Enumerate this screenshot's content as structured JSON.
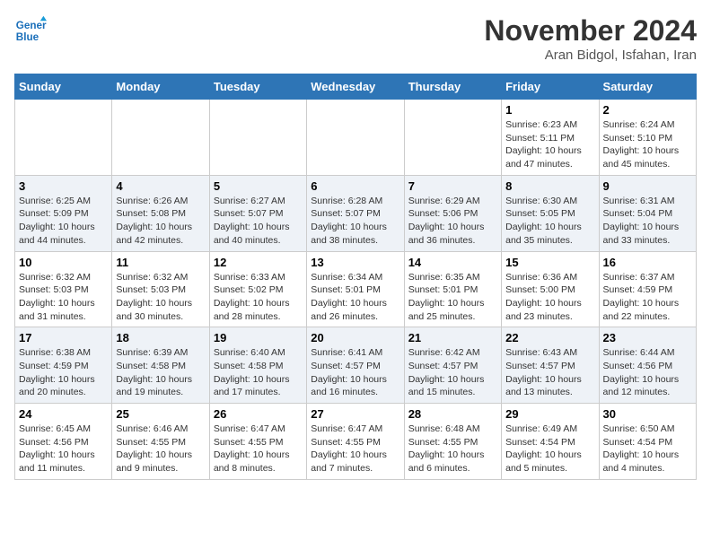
{
  "header": {
    "logo_line1": "General",
    "logo_line2": "Blue",
    "month": "November 2024",
    "location": "Aran Bidgol, Isfahan, Iran"
  },
  "weekdays": [
    "Sunday",
    "Monday",
    "Tuesday",
    "Wednesday",
    "Thursday",
    "Friday",
    "Saturday"
  ],
  "weeks": [
    [
      {
        "day": "",
        "info": ""
      },
      {
        "day": "",
        "info": ""
      },
      {
        "day": "",
        "info": ""
      },
      {
        "day": "",
        "info": ""
      },
      {
        "day": "",
        "info": ""
      },
      {
        "day": "1",
        "info": "Sunrise: 6:23 AM\nSunset: 5:11 PM\nDaylight: 10 hours and 47 minutes."
      },
      {
        "day": "2",
        "info": "Sunrise: 6:24 AM\nSunset: 5:10 PM\nDaylight: 10 hours and 45 minutes."
      }
    ],
    [
      {
        "day": "3",
        "info": "Sunrise: 6:25 AM\nSunset: 5:09 PM\nDaylight: 10 hours and 44 minutes."
      },
      {
        "day": "4",
        "info": "Sunrise: 6:26 AM\nSunset: 5:08 PM\nDaylight: 10 hours and 42 minutes."
      },
      {
        "day": "5",
        "info": "Sunrise: 6:27 AM\nSunset: 5:07 PM\nDaylight: 10 hours and 40 minutes."
      },
      {
        "day": "6",
        "info": "Sunrise: 6:28 AM\nSunset: 5:07 PM\nDaylight: 10 hours and 38 minutes."
      },
      {
        "day": "7",
        "info": "Sunrise: 6:29 AM\nSunset: 5:06 PM\nDaylight: 10 hours and 36 minutes."
      },
      {
        "day": "8",
        "info": "Sunrise: 6:30 AM\nSunset: 5:05 PM\nDaylight: 10 hours and 35 minutes."
      },
      {
        "day": "9",
        "info": "Sunrise: 6:31 AM\nSunset: 5:04 PM\nDaylight: 10 hours and 33 minutes."
      }
    ],
    [
      {
        "day": "10",
        "info": "Sunrise: 6:32 AM\nSunset: 5:03 PM\nDaylight: 10 hours and 31 minutes."
      },
      {
        "day": "11",
        "info": "Sunrise: 6:32 AM\nSunset: 5:03 PM\nDaylight: 10 hours and 30 minutes."
      },
      {
        "day": "12",
        "info": "Sunrise: 6:33 AM\nSunset: 5:02 PM\nDaylight: 10 hours and 28 minutes."
      },
      {
        "day": "13",
        "info": "Sunrise: 6:34 AM\nSunset: 5:01 PM\nDaylight: 10 hours and 26 minutes."
      },
      {
        "day": "14",
        "info": "Sunrise: 6:35 AM\nSunset: 5:01 PM\nDaylight: 10 hours and 25 minutes."
      },
      {
        "day": "15",
        "info": "Sunrise: 6:36 AM\nSunset: 5:00 PM\nDaylight: 10 hours and 23 minutes."
      },
      {
        "day": "16",
        "info": "Sunrise: 6:37 AM\nSunset: 4:59 PM\nDaylight: 10 hours and 22 minutes."
      }
    ],
    [
      {
        "day": "17",
        "info": "Sunrise: 6:38 AM\nSunset: 4:59 PM\nDaylight: 10 hours and 20 minutes."
      },
      {
        "day": "18",
        "info": "Sunrise: 6:39 AM\nSunset: 4:58 PM\nDaylight: 10 hours and 19 minutes."
      },
      {
        "day": "19",
        "info": "Sunrise: 6:40 AM\nSunset: 4:58 PM\nDaylight: 10 hours and 17 minutes."
      },
      {
        "day": "20",
        "info": "Sunrise: 6:41 AM\nSunset: 4:57 PM\nDaylight: 10 hours and 16 minutes."
      },
      {
        "day": "21",
        "info": "Sunrise: 6:42 AM\nSunset: 4:57 PM\nDaylight: 10 hours and 15 minutes."
      },
      {
        "day": "22",
        "info": "Sunrise: 6:43 AM\nSunset: 4:57 PM\nDaylight: 10 hours and 13 minutes."
      },
      {
        "day": "23",
        "info": "Sunrise: 6:44 AM\nSunset: 4:56 PM\nDaylight: 10 hours and 12 minutes."
      }
    ],
    [
      {
        "day": "24",
        "info": "Sunrise: 6:45 AM\nSunset: 4:56 PM\nDaylight: 10 hours and 11 minutes."
      },
      {
        "day": "25",
        "info": "Sunrise: 6:46 AM\nSunset: 4:55 PM\nDaylight: 10 hours and 9 minutes."
      },
      {
        "day": "26",
        "info": "Sunrise: 6:47 AM\nSunset: 4:55 PM\nDaylight: 10 hours and 8 minutes."
      },
      {
        "day": "27",
        "info": "Sunrise: 6:47 AM\nSunset: 4:55 PM\nDaylight: 10 hours and 7 minutes."
      },
      {
        "day": "28",
        "info": "Sunrise: 6:48 AM\nSunset: 4:55 PM\nDaylight: 10 hours and 6 minutes."
      },
      {
        "day": "29",
        "info": "Sunrise: 6:49 AM\nSunset: 4:54 PM\nDaylight: 10 hours and 5 minutes."
      },
      {
        "day": "30",
        "info": "Sunrise: 6:50 AM\nSunset: 4:54 PM\nDaylight: 10 hours and 4 minutes."
      }
    ]
  ]
}
